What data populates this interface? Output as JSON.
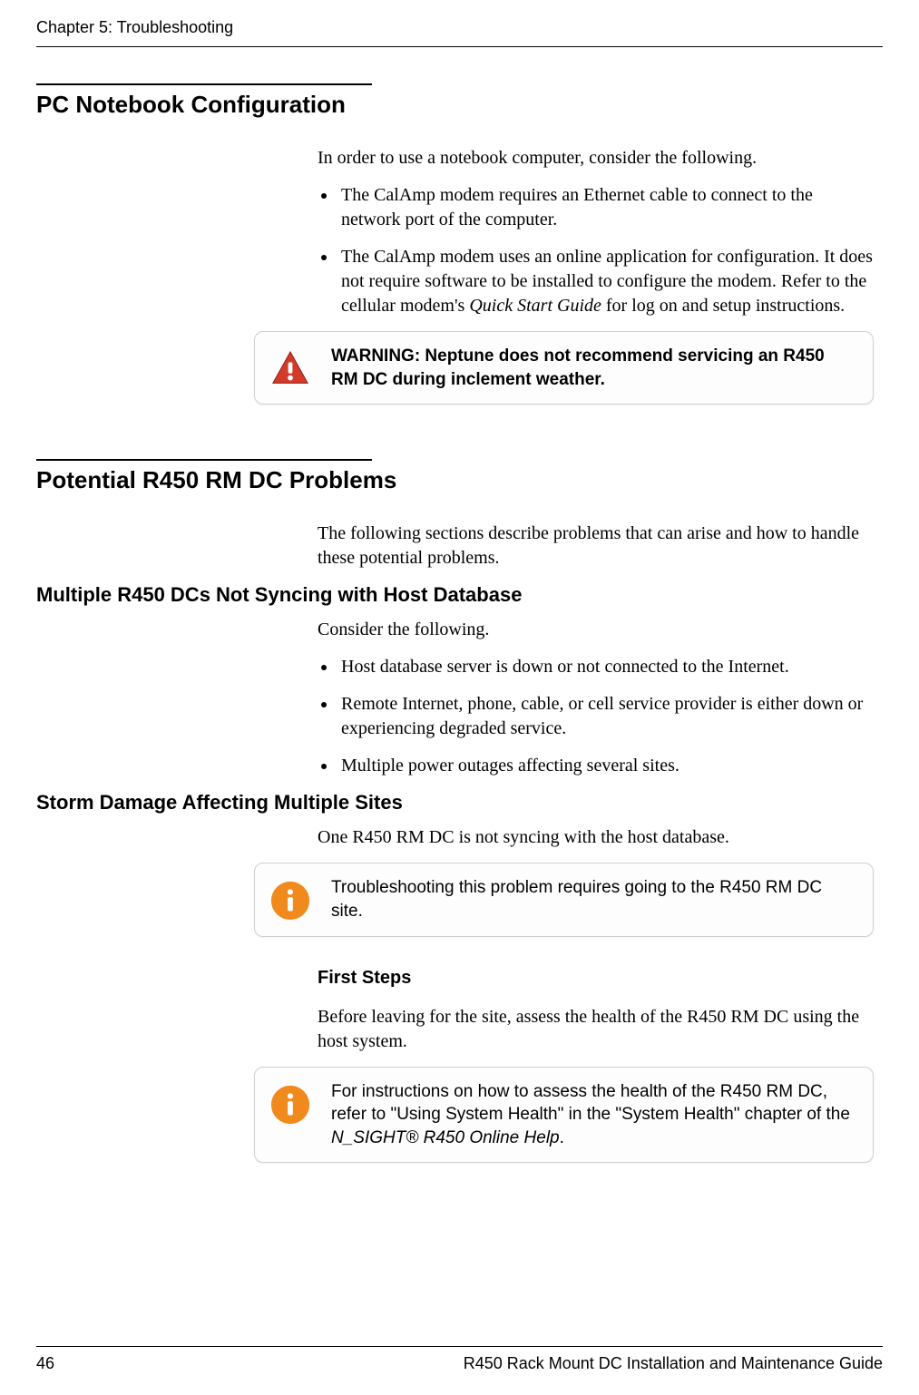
{
  "header": {
    "chapter": "Chapter 5: Troubleshooting"
  },
  "section_pc": {
    "title": "PC Notebook Configuration",
    "intro": "In order to use a notebook computer, consider the following.",
    "bullets": [
      {
        "text": "The CalAmp modem requires an Ethernet cable to connect to the network port of the computer."
      },
      {
        "pre": "The CalAmp modem uses an online application for configuration. It does not require software to be installed to configure the modem. Refer to the cellular modem's ",
        "em": "Quick Start Guide",
        "post": " for log on and setup instructions."
      }
    ],
    "warning": "WARNING: Neptune does not recommend servicing an R450 RM DC during inclement weather."
  },
  "section_problems": {
    "title": "Potential R450 RM DC Problems",
    "intro": "The following sections describe problems that can arise and how to handle these potential problems.",
    "sub_sync": {
      "title": "Multiple R450 DCs Not Syncing with Host Database",
      "intro": "Consider the following.",
      "bullets": [
        "Host database server is down or not connected to the Internet.",
        "Remote Internet, phone, cable, or cell service provider is either down or experiencing degraded service.",
        "Multiple power outages affecting several sites."
      ]
    },
    "sub_storm": {
      "title": "Storm Damage Affecting Multiple Sites",
      "intro": "One R450 RM DC is not syncing with the host database.",
      "info1": "Troubleshooting this problem requires going to the R450 RM DC site.",
      "first_steps_title": "First Steps",
      "first_steps_intro": "Before leaving for the site, assess the health of the R450 RM DC using the host system.",
      "info2_pre": "For instructions on how to assess the health of the R450 RM DC, refer to \"Using System Health\" in the \"System Health\" chapter of the ",
      "info2_em": "N_SIGHT® R450 Online Help",
      "info2_post": "."
    }
  },
  "footer": {
    "page": "46",
    "doc": "R450 Rack Mount DC Installation and Maintenance Guide"
  }
}
